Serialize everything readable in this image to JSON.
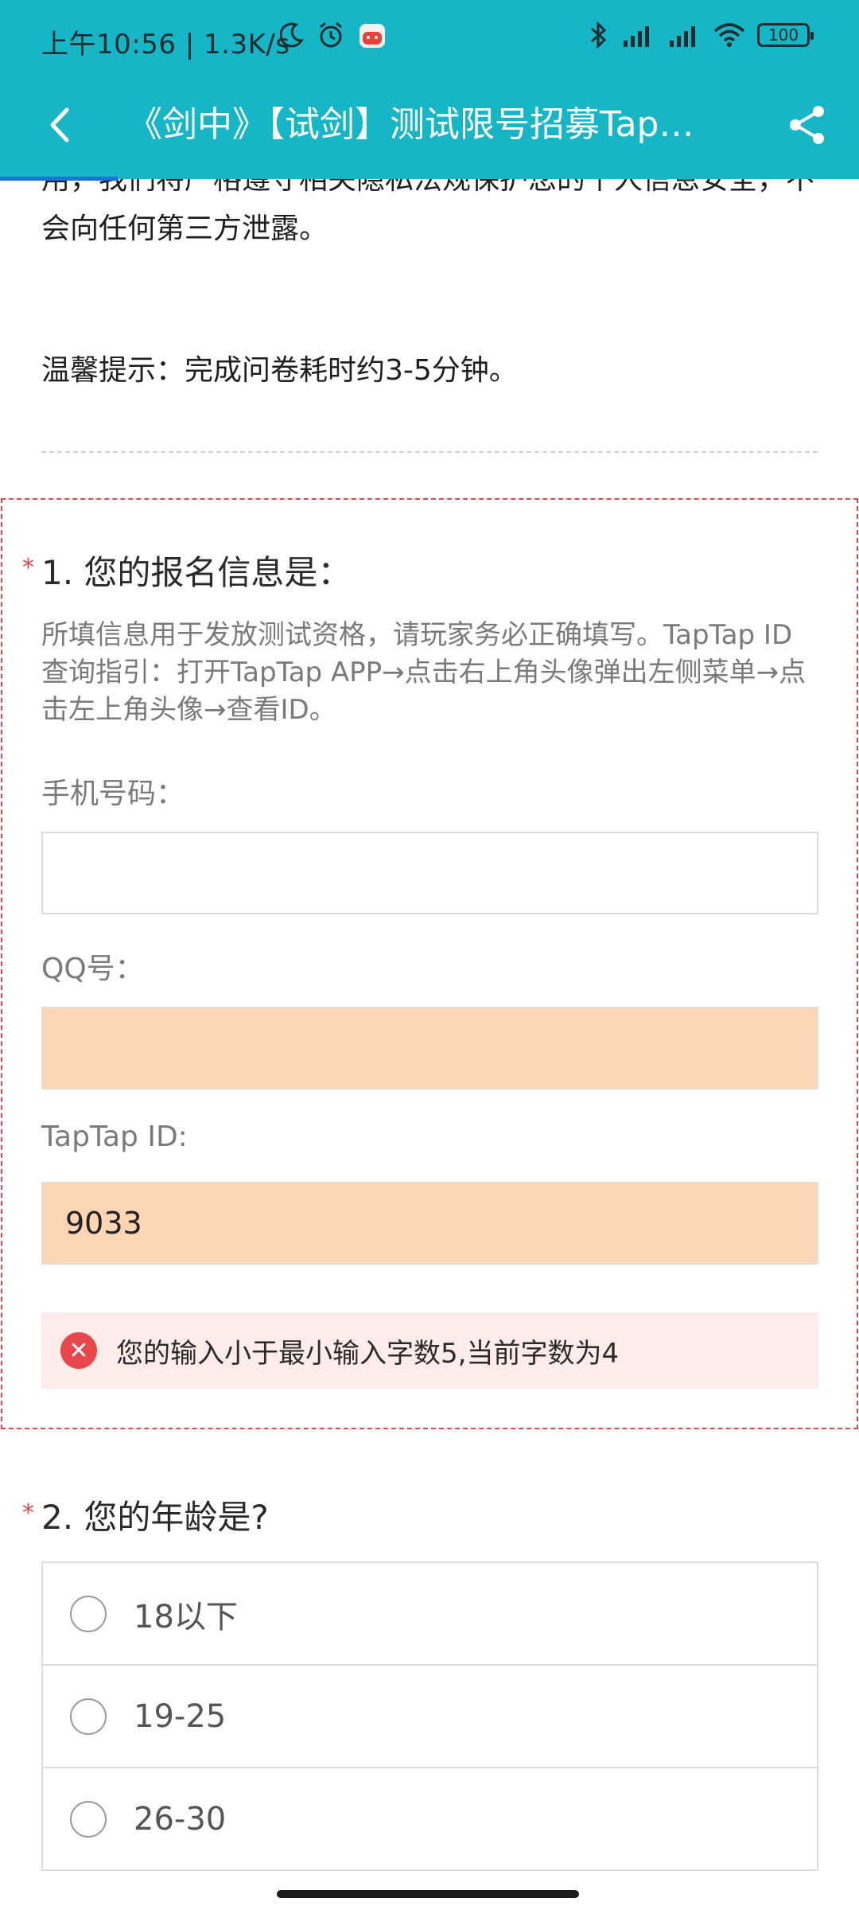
{
  "status_bar": {
    "time": "上午10:56 | 1.3K/s",
    "battery": "100"
  },
  "title_bar": {
    "title": "《剑中》【试剑】测试限号招募Tap…"
  },
  "intro": {
    "text": "用，我们将严格遵守相关隐私法规保护您的个人信息安全，不会向任何第三方泄露。",
    "tip": "温馨提示：完成问卷耗时约3-5分钟。"
  },
  "question1": {
    "required_mark": "*",
    "title": "1. 您的报名信息是：",
    "description": "所填信息用于发放测试资格，请玩家务必正确填写。TapTap ID查询指引：打开TapTap APP→点击右上角头像弹出左侧菜单→点击左上角头像→查看ID。",
    "fields": [
      {
        "label": "手机号码：",
        "value": ""
      },
      {
        "label": "QQ号：",
        "value": ""
      },
      {
        "label": "TapTap ID:",
        "value": "9033"
      }
    ],
    "error": "您的输入小于最小输入字数5,当前字数为4"
  },
  "question2": {
    "required_mark": "*",
    "title": "2. 您的年龄是?",
    "options": [
      "18以下",
      "19-25",
      "26-30"
    ]
  },
  "colors": {
    "header": "#17b6c6",
    "error": "#e0464b",
    "error_bg": "#feeceb",
    "field_error_bg": "#fcd5b5"
  }
}
